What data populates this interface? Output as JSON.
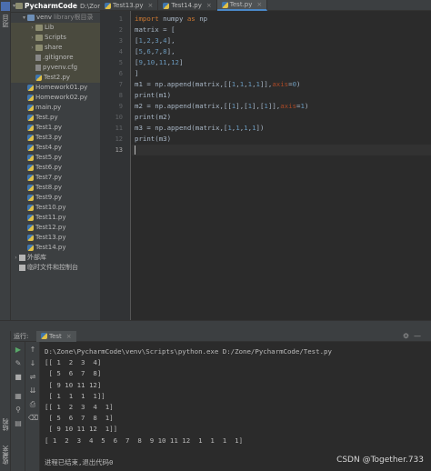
{
  "project": {
    "root_name": "PycharmCode",
    "root_path": "D:\\Zone",
    "items": [
      {
        "label": "venv",
        "hint": "library根目录",
        "depth": 1,
        "icon": "folder-blue",
        "arrow": "▾"
      },
      {
        "label": "Lib",
        "depth": 2,
        "icon": "folder",
        "arrow": "›"
      },
      {
        "label": "Scripts",
        "depth": 2,
        "icon": "folder",
        "arrow": "›"
      },
      {
        "label": "share",
        "depth": 2,
        "icon": "folder",
        "arrow": "›"
      },
      {
        "label": ".gitignore",
        "depth": 2,
        "icon": "cfg",
        "arrow": ""
      },
      {
        "label": "pyvenv.cfg",
        "depth": 2,
        "icon": "cfg",
        "arrow": ""
      },
      {
        "label": "Test2.py",
        "depth": 2,
        "icon": "py",
        "arrow": ""
      },
      {
        "label": "Homework01.py",
        "depth": 1,
        "icon": "py",
        "arrow": ""
      },
      {
        "label": "Homework02.py",
        "depth": 1,
        "icon": "py",
        "arrow": ""
      },
      {
        "label": "main.py",
        "depth": 1,
        "icon": "py",
        "arrow": ""
      },
      {
        "label": "Test.py",
        "depth": 1,
        "icon": "py",
        "arrow": ""
      },
      {
        "label": "Test1.py",
        "depth": 1,
        "icon": "py",
        "arrow": ""
      },
      {
        "label": "Test3.py",
        "depth": 1,
        "icon": "py",
        "arrow": ""
      },
      {
        "label": "Test4.py",
        "depth": 1,
        "icon": "py",
        "arrow": ""
      },
      {
        "label": "Test5.py",
        "depth": 1,
        "icon": "py",
        "arrow": ""
      },
      {
        "label": "Test6.py",
        "depth": 1,
        "icon": "py",
        "arrow": ""
      },
      {
        "label": "Test7.py",
        "depth": 1,
        "icon": "py",
        "arrow": ""
      },
      {
        "label": "Test8.py",
        "depth": 1,
        "icon": "py",
        "arrow": ""
      },
      {
        "label": "Test9.py",
        "depth": 1,
        "icon": "py",
        "arrow": ""
      },
      {
        "label": "Test10.py",
        "depth": 1,
        "icon": "py",
        "arrow": ""
      },
      {
        "label": "Test11.py",
        "depth": 1,
        "icon": "py",
        "arrow": ""
      },
      {
        "label": "Test12.py",
        "depth": 1,
        "icon": "py",
        "arrow": ""
      },
      {
        "label": "Test13.py",
        "depth": 1,
        "icon": "py",
        "arrow": ""
      },
      {
        "label": "Test14.py",
        "depth": 1,
        "icon": "py",
        "arrow": ""
      },
      {
        "label": "外部库",
        "depth": 0,
        "icon": "lib",
        "arrow": "›"
      },
      {
        "label": "临时文件和控制台",
        "depth": 0,
        "icon": "lib",
        "arrow": ""
      }
    ]
  },
  "tabs": [
    {
      "label": "Test13.py",
      "active": false
    },
    {
      "label": "Test14.py",
      "active": false
    },
    {
      "label": "Test.py",
      "active": true
    }
  ],
  "editor": {
    "lines": [
      [
        {
          "t": "import ",
          "c": "kw"
        },
        {
          "t": "numpy "
        },
        {
          "t": "as ",
          "c": "kw"
        },
        {
          "t": "np"
        }
      ],
      [
        {
          "t": "matrix = ["
        }
      ],
      [
        {
          "t": "["
        },
        {
          "t": "1",
          "c": "num"
        },
        {
          "t": ","
        },
        {
          "t": "2",
          "c": "num"
        },
        {
          "t": ","
        },
        {
          "t": "3",
          "c": "num"
        },
        {
          "t": ","
        },
        {
          "t": "4",
          "c": "num"
        },
        {
          "t": "],"
        }
      ],
      [
        {
          "t": "["
        },
        {
          "t": "5",
          "c": "num"
        },
        {
          "t": ","
        },
        {
          "t": "6",
          "c": "num"
        },
        {
          "t": ","
        },
        {
          "t": "7",
          "c": "num"
        },
        {
          "t": ","
        },
        {
          "t": "8",
          "c": "num"
        },
        {
          "t": "],"
        }
      ],
      [
        {
          "t": "["
        },
        {
          "t": "9",
          "c": "num"
        },
        {
          "t": ","
        },
        {
          "t": "10",
          "c": "num"
        },
        {
          "t": ","
        },
        {
          "t": "11",
          "c": "num"
        },
        {
          "t": ","
        },
        {
          "t": "12",
          "c": "num"
        },
        {
          "t": "]"
        }
      ],
      [
        {
          "t": "]"
        }
      ],
      [
        {
          "t": "m1 = np.append(matrix,[["
        },
        {
          "t": "1",
          "c": "num"
        },
        {
          "t": ","
        },
        {
          "t": "1",
          "c": "num"
        },
        {
          "t": ","
        },
        {
          "t": "1",
          "c": "num"
        },
        {
          "t": ","
        },
        {
          "t": "1",
          "c": "num"
        },
        {
          "t": "]],"
        },
        {
          "t": "axis",
          "c": "kwarg"
        },
        {
          "t": "="
        },
        {
          "t": "0",
          "c": "num"
        },
        {
          "t": ")"
        }
      ],
      [
        {
          "t": "print(m1)"
        }
      ],
      [
        {
          "t": "m2 = np.append(matrix,[["
        },
        {
          "t": "1",
          "c": "num"
        },
        {
          "t": "],["
        },
        {
          "t": "1",
          "c": "num"
        },
        {
          "t": "],["
        },
        {
          "t": "1",
          "c": "num"
        },
        {
          "t": "]],"
        },
        {
          "t": "axis",
          "c": "kwarg"
        },
        {
          "t": "="
        },
        {
          "t": "1",
          "c": "num"
        },
        {
          "t": ")"
        }
      ],
      [
        {
          "t": "print(m2)"
        }
      ],
      [
        {
          "t": "m3 = np.append(matrix,["
        },
        {
          "t": "1",
          "c": "num"
        },
        {
          "t": ","
        },
        {
          "t": "1",
          "c": "num"
        },
        {
          "t": ","
        },
        {
          "t": "1",
          "c": "num"
        },
        {
          "t": ","
        },
        {
          "t": "1",
          "c": "num"
        },
        {
          "t": "])"
        }
      ],
      [
        {
          "t": "print(m3)"
        }
      ],
      []
    ],
    "line_numbers": [
      "1",
      "2",
      "3",
      "4",
      "5",
      "6",
      "7",
      "8",
      "9",
      "10",
      "11",
      "12",
      "13"
    ],
    "current_line": 13
  },
  "run": {
    "title": "运行:",
    "tab_label": "Test",
    "output": [
      "D:\\Zone\\PycharmCode\\venv\\Scripts\\python.exe D:/Zone/PycharmCode/Test.py",
      "[[ 1  2  3  4]",
      " [ 5  6  7  8]",
      " [ 9 10 11 12]",
      " [ 1  1  1  1]]",
      "[[ 1  2  3  4  1]",
      " [ 5  6  7  8  1]",
      " [ 9 10 11 12  1]]",
      "[ 1  2  3  4  5  6  7  8  9 10 11 12  1  1  1  1]",
      "",
      "进程已结束,退出代码0"
    ]
  },
  "side_labels": {
    "project": "项目",
    "structure": "结构",
    "favorites": "收藏夹"
  },
  "watermark": "CSDN @Together.733"
}
